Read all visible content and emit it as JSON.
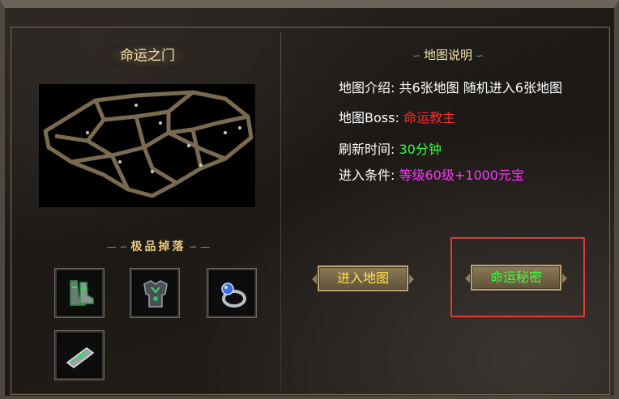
{
  "left": {
    "title": "命运之门",
    "drops_title": "极品掉落",
    "drops": [
      {
        "icon": "boots-icon"
      },
      {
        "icon": "armor-icon"
      },
      {
        "icon": "ring-icon"
      },
      {
        "icon": "bracer-icon"
      }
    ]
  },
  "right": {
    "title": "地图说明",
    "rows": [
      {
        "label": "地图介绍:",
        "value": "共6张地图 随机进入6张地图",
        "color": "#ffffff"
      },
      {
        "label": "地图Boss:",
        "value": "命运教主",
        "color": "#ff2a2a"
      },
      {
        "label": "刷新时间:",
        "value": "30分钟",
        "color": "#33ff3a"
      },
      {
        "label": "进入条件:",
        "value": "等级60级+1000元宝",
        "color": "#ff33ff"
      }
    ],
    "buttons": {
      "enter_label": "进入地图",
      "secret_label": "命运秘密"
    }
  },
  "colors": {
    "highlight": "#e43a3a",
    "title_gold": "#f5e4a8",
    "enter_text": "#ffe14a",
    "secret_text": "#3cff3c"
  }
}
